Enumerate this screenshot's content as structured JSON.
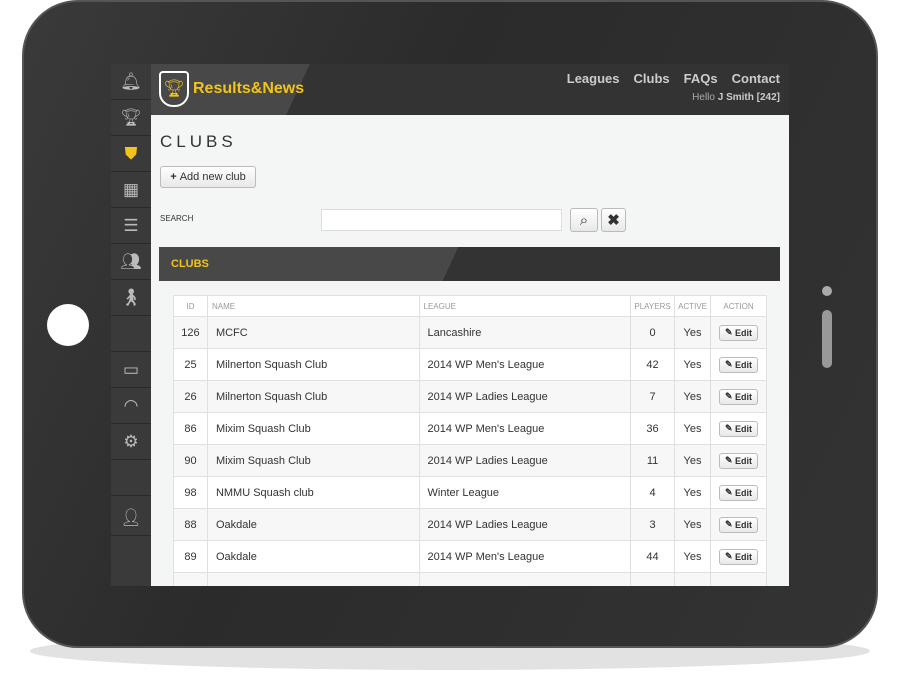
{
  "brand": {
    "name": "Results&News",
    "accent": "#f2c417"
  },
  "nav": [
    "Leagues",
    "Clubs",
    "FAQs",
    "Contact"
  ],
  "user": {
    "greeting": "Hello",
    "name": "J Smith [242]"
  },
  "sidebar": [
    "bell-icon",
    "trophy-icon",
    "shield-icon",
    "building-icon",
    "list-icon",
    "group-icon",
    "person-icon",
    "credit-card-icon",
    "rss-icon",
    "gear-icon",
    "user-icon"
  ],
  "page": {
    "title": "CLUBS",
    "add_label": "Add new club",
    "search_label": "SEARCH",
    "search_value": ""
  },
  "panel": {
    "title": "CLUBS"
  },
  "table": {
    "headers": [
      "ID",
      "NAME",
      "LEAGUE",
      "PLAYERS",
      "ACTIVE",
      "ACTION"
    ],
    "edit_label": "Edit",
    "rows": [
      [
        "126",
        "MCFC",
        "Lancashire",
        "0",
        "Yes"
      ],
      [
        "25",
        "Milnerton Squash Club",
        "2014 WP Men's League",
        "42",
        "Yes"
      ],
      [
        "26",
        "Milnerton Squash Club",
        "2014 WP Ladies League",
        "7",
        "Yes"
      ],
      [
        "86",
        "Mixim Squash Club",
        "2014 WP Men's League",
        "36",
        "Yes"
      ],
      [
        "90",
        "Mixim Squash Club",
        "2014 WP Ladies League",
        "11",
        "Yes"
      ],
      [
        "98",
        "NMMU Squash club",
        "Winter League",
        "4",
        "Yes"
      ],
      [
        "88",
        "Oakdale",
        "2014 WP Ladies League",
        "3",
        "Yes"
      ],
      [
        "89",
        "Oakdale",
        "2014 WP Men's League",
        "44",
        "Yes"
      ]
    ]
  }
}
